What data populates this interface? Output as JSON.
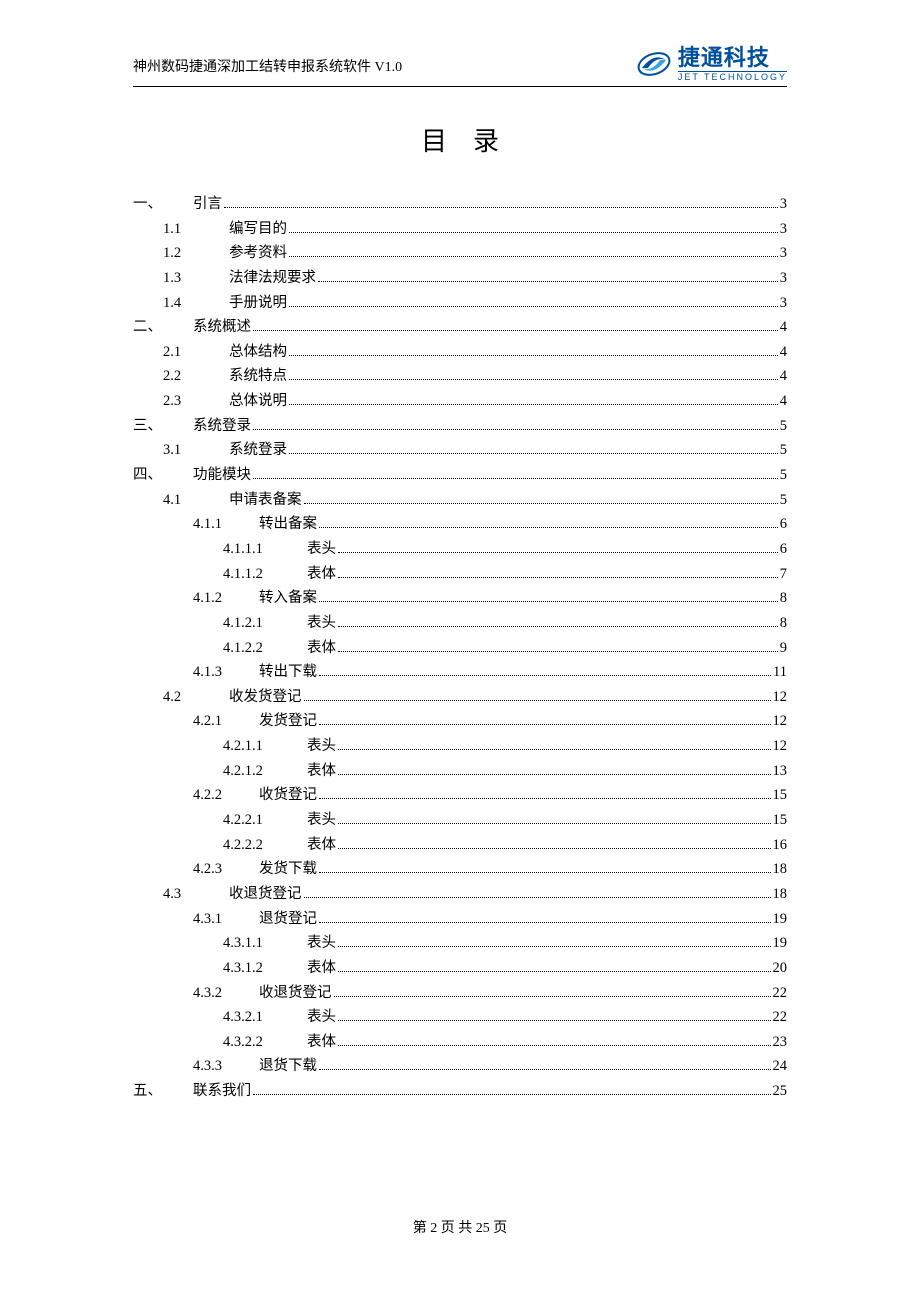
{
  "header": {
    "doc_title": "神州数码捷通深加工结转申报系统软件 V1.0",
    "logo_cn": "捷通科技",
    "logo_en": "JET TECHNOLOGY"
  },
  "page_title": "目录",
  "footer": "第 2 页 共 25 页",
  "toc": [
    {
      "level": 1,
      "num": "一、",
      "label": "引言",
      "page": "3"
    },
    {
      "level": 2,
      "num": "1.1",
      "label": "编写目的",
      "page": "3"
    },
    {
      "level": 2,
      "num": "1.2",
      "label": "参考资料",
      "page": "3"
    },
    {
      "level": 2,
      "num": "1.3",
      "label": "法律法规要求",
      "page": "3"
    },
    {
      "level": 2,
      "num": "1.4",
      "label": "手册说明",
      "page": "3"
    },
    {
      "level": 1,
      "num": "二、",
      "label": "系统概述",
      "page": "4"
    },
    {
      "level": 2,
      "num": "2.1",
      "label": "总体结构",
      "page": "4"
    },
    {
      "level": 2,
      "num": "2.2",
      "label": "系统特点",
      "page": "4"
    },
    {
      "level": 2,
      "num": "2.3",
      "label": "总体说明",
      "page": "4"
    },
    {
      "level": 1,
      "num": "三、",
      "label": "系统登录",
      "page": "5"
    },
    {
      "level": 2,
      "num": "3.1",
      "label": "系统登录",
      "page": "5"
    },
    {
      "level": 1,
      "num": "四、",
      "label": "功能模块",
      "page": "5"
    },
    {
      "level": 2,
      "num": "4.1",
      "label": "申请表备案",
      "page": "5"
    },
    {
      "level": 3,
      "num": "4.1.1",
      "label": "转出备案",
      "page": "6"
    },
    {
      "level": 4,
      "num": "4.1.1.1",
      "label": "表头",
      "page": "6"
    },
    {
      "level": 4,
      "num": "4.1.1.2",
      "label": "表体",
      "page": "7"
    },
    {
      "level": 3,
      "num": "4.1.2",
      "label": "转入备案",
      "page": "8"
    },
    {
      "level": 4,
      "num": "4.1.2.1",
      "label": "表头",
      "page": "8"
    },
    {
      "level": 4,
      "num": "4.1.2.2",
      "label": "表体",
      "page": "9"
    },
    {
      "level": 3,
      "num": "4.1.3",
      "label": "转出下载",
      "page": "11"
    },
    {
      "level": 2,
      "num": "4.2",
      "label": "收发货登记",
      "page": "12"
    },
    {
      "level": 3,
      "num": "4.2.1",
      "label": "发货登记",
      "page": "12"
    },
    {
      "level": 4,
      "num": "4.2.1.1",
      "label": "表头",
      "page": "12"
    },
    {
      "level": 4,
      "num": "4.2.1.2",
      "label": "表体",
      "page": "13"
    },
    {
      "level": 3,
      "num": "4.2.2",
      "label": "收货登记",
      "page": "15"
    },
    {
      "level": 4,
      "num": "4.2.2.1",
      "label": "表头",
      "page": "15"
    },
    {
      "level": 4,
      "num": "4.2.2.2",
      "label": "表体",
      "page": "16"
    },
    {
      "level": 3,
      "num": "4.2.3",
      "label": "发货下载",
      "page": "18"
    },
    {
      "level": 2,
      "num": "4.3",
      "label": "收退货登记",
      "page": "18"
    },
    {
      "level": 3,
      "num": "4.3.1",
      "label": "退货登记",
      "page": "19"
    },
    {
      "level": 4,
      "num": "4.3.1.1",
      "label": "表头",
      "page": "19"
    },
    {
      "level": 4,
      "num": "4.3.1.2",
      "label": "表体",
      "page": "20"
    },
    {
      "level": 3,
      "num": "4.3.2",
      "label": "收退货登记",
      "page": "22"
    },
    {
      "level": 4,
      "num": "4.3.2.1",
      "label": "表头",
      "page": "22"
    },
    {
      "level": 4,
      "num": "4.3.2.2",
      "label": "表体",
      "page": "23"
    },
    {
      "level": 3,
      "num": "4.3.3",
      "label": "退货下载",
      "page": "24"
    },
    {
      "level": 1,
      "num": "五、",
      "label": "联系我们",
      "page": "25"
    }
  ]
}
